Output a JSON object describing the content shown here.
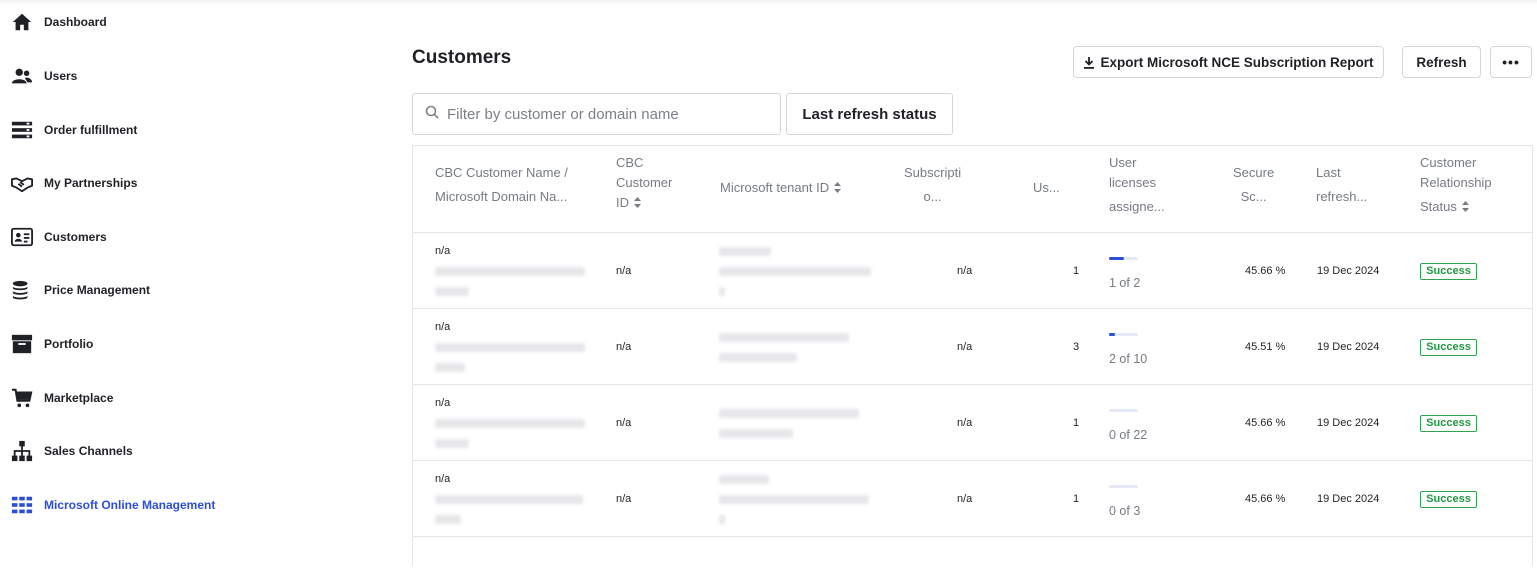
{
  "nav": {
    "items": [
      {
        "label": "Dashboard",
        "icon": "home-icon"
      },
      {
        "label": "Users",
        "icon": "users-icon"
      },
      {
        "label": "Order fulfillment",
        "icon": "server-icon"
      },
      {
        "label": "My Partnerships",
        "icon": "handshake-icon"
      },
      {
        "label": "Customers",
        "icon": "id-card-icon"
      },
      {
        "label": "Price Management",
        "icon": "coins-icon"
      },
      {
        "label": "Portfolio",
        "icon": "archive-box-icon"
      },
      {
        "label": "Marketplace",
        "icon": "cart-icon"
      },
      {
        "label": "Sales Channels",
        "icon": "sitemap-icon"
      },
      {
        "label": "Microsoft Online Management",
        "icon": "grid-icon",
        "active": true
      }
    ]
  },
  "page": {
    "title": "Customers"
  },
  "toolbar": {
    "export_label": "Export Microsoft NCE Subscription Report",
    "refresh_label": "Refresh",
    "more_label": "•••",
    "last_refresh_label": "Last refresh status"
  },
  "search": {
    "placeholder": "Filter by customer or domain name",
    "value": ""
  },
  "table": {
    "headers": {
      "name": [
        "CBC Customer Name /",
        "Microsoft Domain Na..."
      ],
      "cbc_id": [
        "CBC",
        "Customer",
        "ID"
      ],
      "tenant": [
        "Microsoft tenant ID"
      ],
      "subscriptions": [
        "Subscripti",
        "o..."
      ],
      "users": [
        "Us..."
      ],
      "licenses": [
        "User",
        "licenses",
        "assigne..."
      ],
      "secure": [
        "Secure",
        "Sc..."
      ],
      "last_refresh": [
        "Last",
        "refresh..."
      ],
      "relationship": [
        "Customer",
        "Relationship",
        "Status"
      ]
    },
    "rows": [
      {
        "name": "n/a",
        "cbc_id": "n/a",
        "subscriptions": "n/a",
        "users": "1",
        "licenses_text": "1 of 2",
        "licenses_fraction": 0.5,
        "secure_score": "45.66 %",
        "last_refresh": "19 Dec 2024",
        "status": "Success"
      },
      {
        "name": "n/a",
        "cbc_id": "n/a",
        "subscriptions": "n/a",
        "users": "3",
        "licenses_text": "2 of 10",
        "licenses_fraction": 0.2,
        "secure_score": "45.51 %",
        "last_refresh": "19 Dec 2024",
        "status": "Success"
      },
      {
        "name": "n/a",
        "cbc_id": "n/a",
        "subscriptions": "n/a",
        "users": "1",
        "licenses_text": "0 of 22",
        "licenses_fraction": 0.0,
        "secure_score": "45.66 %",
        "last_refresh": "19 Dec 2024",
        "status": "Success"
      },
      {
        "name": "n/a",
        "cbc_id": "n/a",
        "subscriptions": "n/a",
        "users": "1",
        "licenses_text": "0 of 3",
        "licenses_fraction": 0.0,
        "secure_score": "45.66 %",
        "last_refresh": "19 Dec 2024",
        "status": "Success"
      }
    ]
  },
  "colors": {
    "accent": "#2d4fd7",
    "success": "#1f9a3f",
    "border": "#e3e5e8",
    "muted_text": "#767b84"
  }
}
